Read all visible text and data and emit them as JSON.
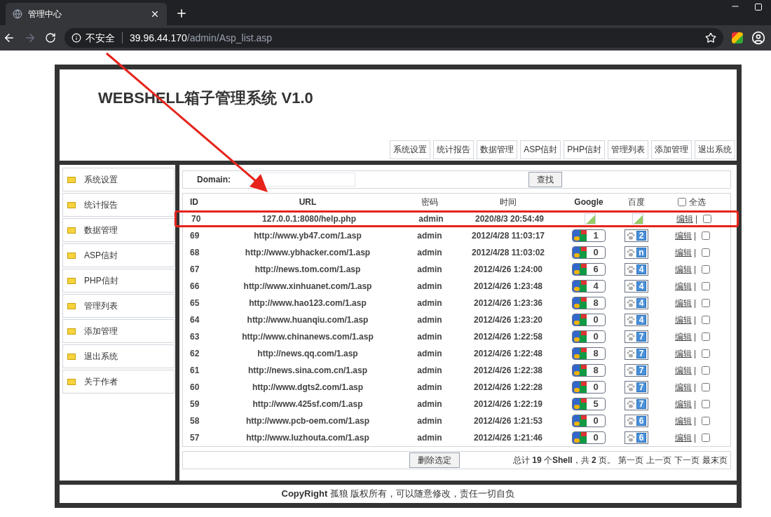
{
  "browser": {
    "tab_title": "管理中心",
    "security_label": "不安全",
    "url_host": "39.96.44.170",
    "url_path": "/admin/Asp_list.asp"
  },
  "header": {
    "title": "WEBSHELL箱子管理系统 V1.0"
  },
  "top_nav": [
    "系统设置",
    "统计报告",
    "数据管理",
    "ASP信封",
    "PHP信封",
    "管理列表",
    "添加管理",
    "退出系统"
  ],
  "sidebar": {
    "items": [
      "系统设置",
      "统计报告",
      "数据管理",
      "ASP信封",
      "PHP信封",
      "管理列表",
      "添加管理",
      "退出系统",
      "关于作者"
    ]
  },
  "search": {
    "label": "Domain:",
    "button": "查找"
  },
  "table": {
    "columns": [
      "ID",
      "URL",
      "密码",
      "时间",
      "Google",
      "百度"
    ],
    "select_all": {
      "label": "全选",
      "checked": false
    },
    "rows": [
      {
        "id": "70",
        "url": "127.0.0.1:8080/help.php",
        "password": "admin",
        "time": "2020/8/3 20:54:49",
        "google": {
          "kind": "broken"
        },
        "baidu": {
          "kind": "broken"
        },
        "edit": "编辑",
        "sep": "|",
        "checked": false,
        "annotated": true
      },
      {
        "id": "69",
        "url": "http://www.yb47.com/1.asp",
        "password": "admin",
        "time": "2012/4/28 11:03:17",
        "google": {
          "kind": "badge",
          "value": "1"
        },
        "baidu": {
          "kind": "badge",
          "value": "2"
        },
        "edit": "编辑",
        "sep": "|",
        "checked": false
      },
      {
        "id": "68",
        "url": "http://www.ybhacker.com/1.asp",
        "password": "admin",
        "time": "2012/4/28 11:03:02",
        "google": {
          "kind": "badge",
          "value": "0"
        },
        "baidu": {
          "kind": "badge",
          "value": "n"
        },
        "edit": "编辑",
        "sep": "|",
        "checked": false
      },
      {
        "id": "67",
        "url": "http://news.tom.com/1.asp",
        "password": "admin",
        "time": "2012/4/26 1:24:00",
        "google": {
          "kind": "badge",
          "value": "6"
        },
        "baidu": {
          "kind": "badge",
          "value": "4"
        },
        "edit": "编辑",
        "sep": "|",
        "checked": false
      },
      {
        "id": "66",
        "url": "http://www.xinhuanet.com/1.asp",
        "password": "admin",
        "time": "2012/4/26 1:23:48",
        "google": {
          "kind": "badge",
          "value": "4"
        },
        "baidu": {
          "kind": "badge",
          "value": "4"
        },
        "edit": "编辑",
        "sep": "|",
        "checked": false
      },
      {
        "id": "65",
        "url": "http://www.hao123.com/1.asp",
        "password": "admin",
        "time": "2012/4/26 1:23:36",
        "google": {
          "kind": "badge",
          "value": "8"
        },
        "baidu": {
          "kind": "badge",
          "value": "4"
        },
        "edit": "编辑",
        "sep": "|",
        "checked": false
      },
      {
        "id": "64",
        "url": "http://www.huanqiu.com/1.asp",
        "password": "admin",
        "time": "2012/4/26 1:23:20",
        "google": {
          "kind": "badge",
          "value": "0"
        },
        "baidu": {
          "kind": "badge",
          "value": "4"
        },
        "edit": "编辑",
        "sep": "|",
        "checked": false
      },
      {
        "id": "63",
        "url": "http://www.chinanews.com/1.asp",
        "password": "admin",
        "time": "2012/4/26 1:22:58",
        "google": {
          "kind": "badge",
          "value": "0"
        },
        "baidu": {
          "kind": "badge",
          "value": "7"
        },
        "edit": "编辑",
        "sep": "|",
        "checked": false
      },
      {
        "id": "62",
        "url": "http://news.qq.com/1.asp",
        "password": "admin",
        "time": "2012/4/26 1:22:48",
        "google": {
          "kind": "badge",
          "value": "8"
        },
        "baidu": {
          "kind": "badge",
          "value": "7"
        },
        "edit": "编辑",
        "sep": "|",
        "checked": false
      },
      {
        "id": "61",
        "url": "http://news.sina.com.cn/1.asp",
        "password": "admin",
        "time": "2012/4/26 1:22:38",
        "google": {
          "kind": "badge",
          "value": "8"
        },
        "baidu": {
          "kind": "badge",
          "value": "7"
        },
        "edit": "编辑",
        "sep": "|",
        "checked": false
      },
      {
        "id": "60",
        "url": "http://www.dgts2.com/1.asp",
        "password": "admin",
        "time": "2012/4/26 1:22:28",
        "google": {
          "kind": "badge",
          "value": "0"
        },
        "baidu": {
          "kind": "badge",
          "value": "7"
        },
        "edit": "编辑",
        "sep": "|",
        "checked": false
      },
      {
        "id": "59",
        "url": "http://www.425sf.com/1.asp",
        "password": "admin",
        "time": "2012/4/26 1:22:19",
        "google": {
          "kind": "badge",
          "value": "5"
        },
        "baidu": {
          "kind": "badge",
          "value": "7"
        },
        "edit": "编辑",
        "sep": "|",
        "checked": false
      },
      {
        "id": "58",
        "url": "http://www.pcb-oem.com/1.asp",
        "password": "admin",
        "time": "2012/4/26 1:21:53",
        "google": {
          "kind": "badge",
          "value": "0"
        },
        "baidu": {
          "kind": "badge",
          "value": "6"
        },
        "edit": "编辑",
        "sep": "|",
        "checked": false
      },
      {
        "id": "57",
        "url": "http://www.luzhouta.com/1.asp",
        "password": "admin",
        "time": "2012/4/26 1:21:46",
        "google": {
          "kind": "badge",
          "value": "0"
        },
        "baidu": {
          "kind": "badge",
          "value": "6"
        },
        "edit": "编辑",
        "sep": "|",
        "checked": false
      }
    ]
  },
  "footer_bar": {
    "delete_button": "删除选定",
    "summary": "总计 **19** 个**Shell**，共 **2** 页。",
    "pages": [
      "第一页",
      "上一页",
      "下一页",
      "最末页"
    ]
  },
  "copyright": "**CopyRight** 孤狼 版权所有，可以随意修改，责任一切自负"
}
